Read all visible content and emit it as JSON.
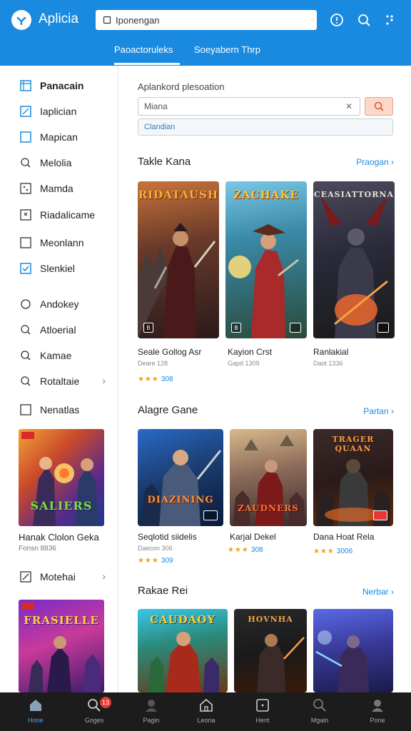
{
  "header": {
    "app_title": "Aplicia",
    "search_value": "Iponengan",
    "tabs": [
      {
        "label": "Paoactoruleks",
        "active": true
      },
      {
        "label": "Soeyabern Thrp",
        "active": false
      }
    ]
  },
  "sidebar": {
    "items": [
      {
        "label": "Panacain",
        "icon": "panel-icon",
        "active": true
      },
      {
        "label": "Iaplician",
        "icon": "edit-icon"
      },
      {
        "label": "Mapican",
        "icon": "square-icon"
      },
      {
        "label": "Melolia",
        "icon": "search-icon"
      },
      {
        "label": "Mamda",
        "icon": "grid-icon"
      },
      {
        "label": "Riadalicame",
        "icon": "puzzle-icon"
      },
      {
        "label": "Meonlann",
        "icon": "square-icon"
      },
      {
        "label": "Slenkiel",
        "icon": "checkbox-icon"
      },
      {
        "label": "Andokey",
        "icon": "circle-icon"
      },
      {
        "label": "Atloerial",
        "icon": "search-icon"
      },
      {
        "label": "Kamae",
        "icon": "search-icon"
      },
      {
        "label": "Rotaltaie",
        "icon": "search-icon",
        "chevron": true
      },
      {
        "label": "Nenatlas",
        "icon": "square-icon"
      },
      {
        "label": "Motehai",
        "icon": "edit-icon",
        "chevron": true
      }
    ],
    "card1": {
      "title": "Hanak Clolon Geka",
      "meta": "Fonsn 8836",
      "logo": "SALIERS"
    },
    "card2": {
      "logo": "FRASIELLE"
    }
  },
  "filter": {
    "title": "Aplankord plesoation",
    "input_value": "Miana",
    "clear": "✕",
    "select_value": "Clandian"
  },
  "sections": [
    {
      "title": "Takle Kana",
      "link": "Praogan",
      "games": [
        {
          "title": "Seale Gollog Asr",
          "meta": "Deare 128",
          "rating": "308",
          "logo": "RIDATAUSH"
        },
        {
          "title": "Kayion Crst",
          "meta": "Gapd 1309",
          "logo": "ZACHAKE"
        },
        {
          "title": "Ranlakial",
          "meta": "Daot 1336",
          "logo": "CEASIATTORNA"
        }
      ]
    },
    {
      "title": "Alagre Gane",
      "link": "Partan",
      "games": [
        {
          "title": "Seqlotid siidelis",
          "meta": "Daecon 306",
          "rating": "309",
          "logo": "DIAZINING"
        },
        {
          "title": "Karjal Dekel",
          "rating": "308",
          "logo": "ZAUDNERS"
        },
        {
          "title": "Dana Hoat Rela",
          "rating": "3006",
          "logo": "TRAGER QUAAN"
        }
      ]
    },
    {
      "title": "Rakae Rei",
      "link": "Nerbar",
      "games": [
        {
          "logo": "CAUDAOY"
        },
        {
          "logo": "HOVNHA"
        },
        {
          "logo": ""
        }
      ]
    }
  ],
  "bottom_nav": {
    "items": [
      {
        "label": "Hone",
        "icon": "home-icon",
        "active": true
      },
      {
        "label": "Goges",
        "icon": "search-icon"
      },
      {
        "label": "Pagin",
        "icon": "profile-icon"
      },
      {
        "label": "Leona",
        "icon": "house-icon"
      },
      {
        "label": "Hent",
        "icon": "tv-icon"
      },
      {
        "label": "Mgain",
        "icon": "search-icon"
      },
      {
        "label": "Pone",
        "icon": "person-icon"
      }
    ],
    "notification_count": "13"
  },
  "colors": {
    "accent": "#1a8ae0",
    "star": "#f0a020",
    "nav_bg": "#1c1c1c"
  }
}
